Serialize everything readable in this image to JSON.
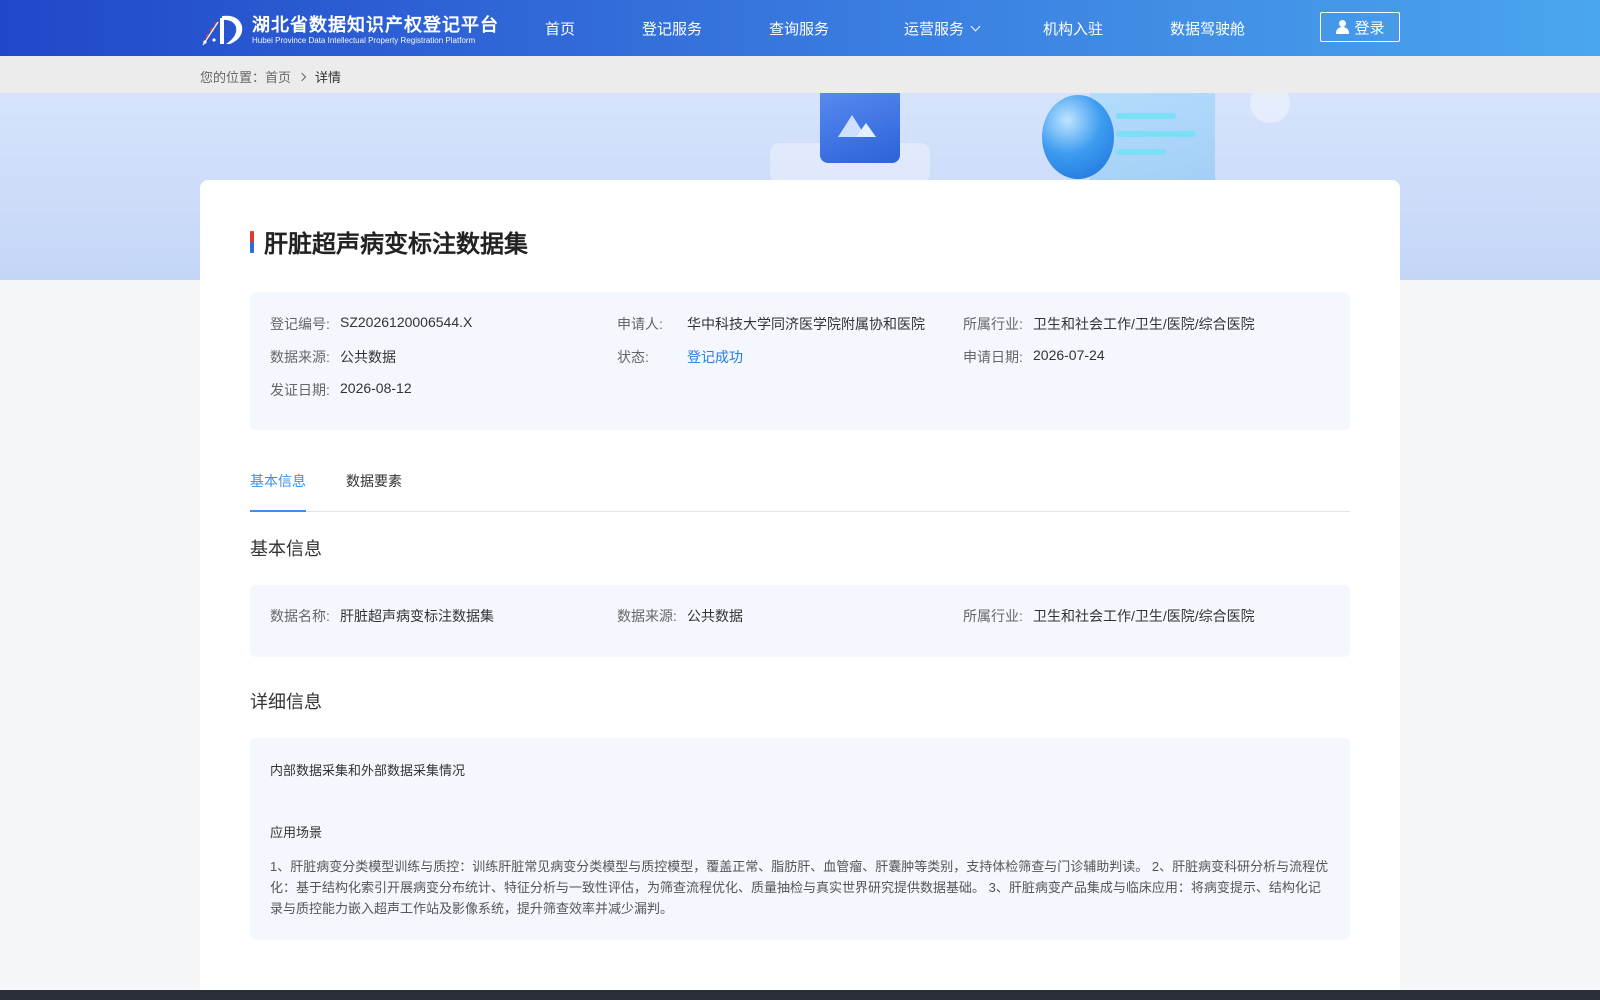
{
  "header": {
    "logo_cn": "湖北省数据知识产权登记平台",
    "logo_en": "Hubei Province Data Intellectual Property Registration Platform",
    "nav": [
      {
        "label": "首页"
      },
      {
        "label": "登记服务"
      },
      {
        "label": "查询服务"
      },
      {
        "label": "运营服务"
      },
      {
        "label": "机构入驻"
      },
      {
        "label": "数据驾驶舱"
      }
    ],
    "login_label": "登录"
  },
  "breadcrumb": {
    "prefix": "您的位置：",
    "home": "首页",
    "current": "详情"
  },
  "title": "肝脏超声病变标注数据集",
  "summary": {
    "reg_no": {
      "label": "登记编号:",
      "value": "SZ2026120006544.X"
    },
    "applicant": {
      "label": "申请人:",
      "value": "华中科技大学同济医学院附属协和医院"
    },
    "industry": {
      "label": "所属行业:",
      "value": "卫生和社会工作/卫生/医院/综合医院"
    },
    "source": {
      "label": "数据来源:",
      "value": "公共数据"
    },
    "status": {
      "label": "状态:",
      "value": "登记成功"
    },
    "apply_date": {
      "label": "申请日期:",
      "value": "2026-07-24"
    },
    "cert_date": {
      "label": "发证日期:",
      "value": "2026-08-12"
    }
  },
  "tabs": [
    {
      "label": "基本信息"
    },
    {
      "label": "数据要素"
    }
  ],
  "basic": {
    "heading": "基本信息",
    "name": {
      "label": "数据名称:",
      "value": "肝脏超声病变标注数据集"
    },
    "source": {
      "label": "数据来源:",
      "value": "公共数据"
    },
    "industry": {
      "label": "所属行业:",
      "value": "卫生和社会工作/卫生/医院/综合医院"
    }
  },
  "detail": {
    "heading": "详细信息",
    "collection_heading": "内部数据采集和外部数据采集情况",
    "scenario_heading": "应用场景",
    "scenario_text": "1、肝脏病变分类模型训练与质控：训练肝脏常见病变分类模型与质控模型，覆盖正常、脂肪肝、血管瘤、肝囊肿等类别，支持体检筛查与门诊辅助判读。 2、肝脏病变科研分析与流程优化：基于结构化索引开展病变分布统计、特征分析与一致性评估，为筛查流程优化、质量抽检与真实世界研究提供数据基础。 3、肝脏病变产品集成与临床应用：将病变提示、结构化记录与质控能力嵌入超声工作站及影像系统，提升筛查效率并减少漏判。"
  }
}
